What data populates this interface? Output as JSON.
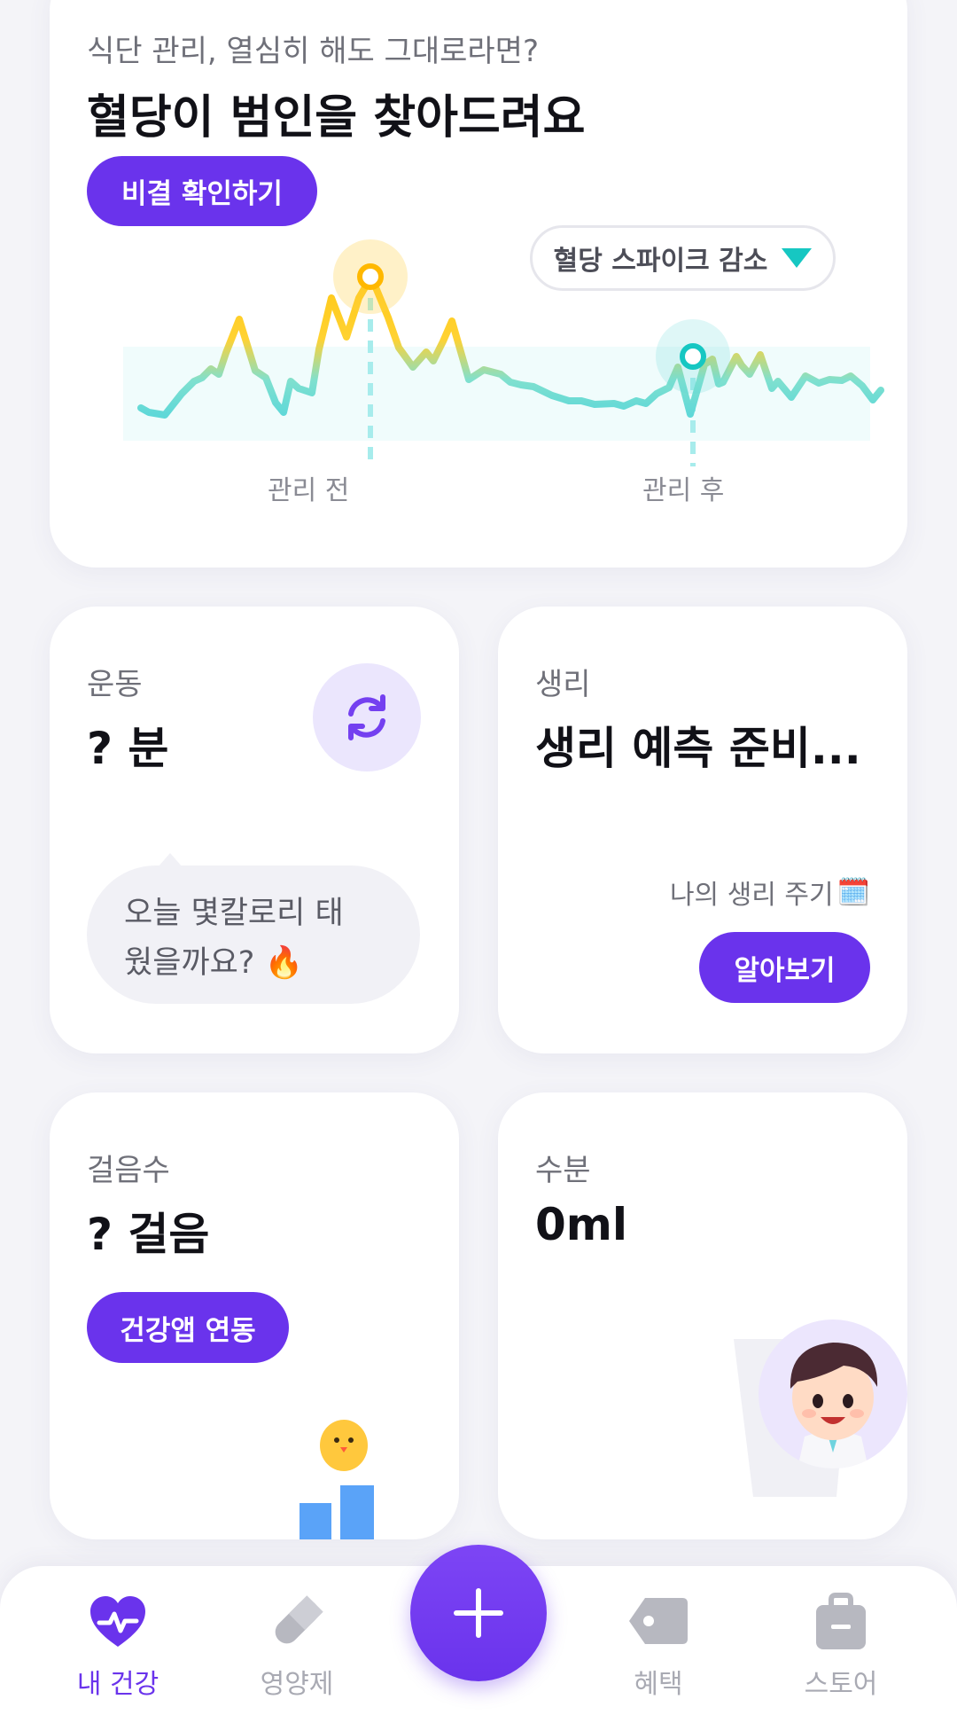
{
  "glucose_card": {
    "subtitle": "식단 관리, 열심히 해도 그대로라면?",
    "title": "혈당이 범인을 찾아드려요",
    "button": "비결 확인하기",
    "spike_badge": "혈당 스파이크 감소",
    "label_before": "관리 전",
    "label_after": "관리 후"
  },
  "exercise_card": {
    "label": "운동",
    "value": "? 분",
    "bubble_line1": "오늘 몇칼로리 태",
    "bubble_line2": "웠을까요? 🔥"
  },
  "period_card": {
    "label": "생리",
    "value": "생리 예측 준비...",
    "cycle_text": "나의 생리 주기",
    "cycle_emoji": "🗓️",
    "button": "알아보기"
  },
  "steps_card": {
    "label": "걸음수",
    "value": "? 걸음",
    "button": "건강앱 연동"
  },
  "water_card": {
    "label": "수분",
    "value": "0ml"
  },
  "bottom_nav": {
    "items": [
      {
        "label": "내 건강",
        "icon": "heart-pulse-icon",
        "active": true
      },
      {
        "label": "영양제",
        "icon": "pill-icon",
        "active": false
      },
      {
        "label": "혜택",
        "icon": "tag-icon",
        "active": false
      },
      {
        "label": "스토어",
        "icon": "shopping-bag-icon",
        "active": false
      }
    ],
    "center_button_icon": "plus-icon"
  },
  "colors": {
    "accent": "#6a33ec",
    "teal": "#16c7c2",
    "peak": "#ffc21a"
  }
}
